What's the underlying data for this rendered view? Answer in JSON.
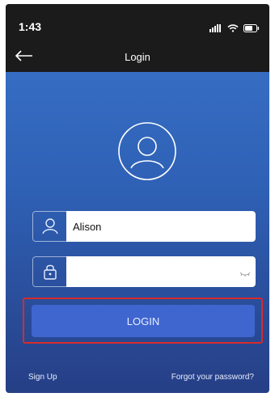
{
  "statusbar": {
    "time": "1:43"
  },
  "header": {
    "title": "Login"
  },
  "form": {
    "username_value": "Alison",
    "password_value": ""
  },
  "buttons": {
    "login_label": "LOGIN"
  },
  "links": {
    "sign_up": "Sign Up",
    "forgot_password": "Forgot your password?"
  },
  "colors": {
    "primary": "#3f66cf",
    "background_top": "#3a73c9",
    "background_bottom": "#263f86",
    "highlight": "#d72b2b"
  },
  "icons": {
    "back": "arrow-left-icon",
    "avatar": "user-circle-icon",
    "user": "user-icon",
    "lock": "lock-icon",
    "password_toggle": "eye-closed-icon"
  }
}
